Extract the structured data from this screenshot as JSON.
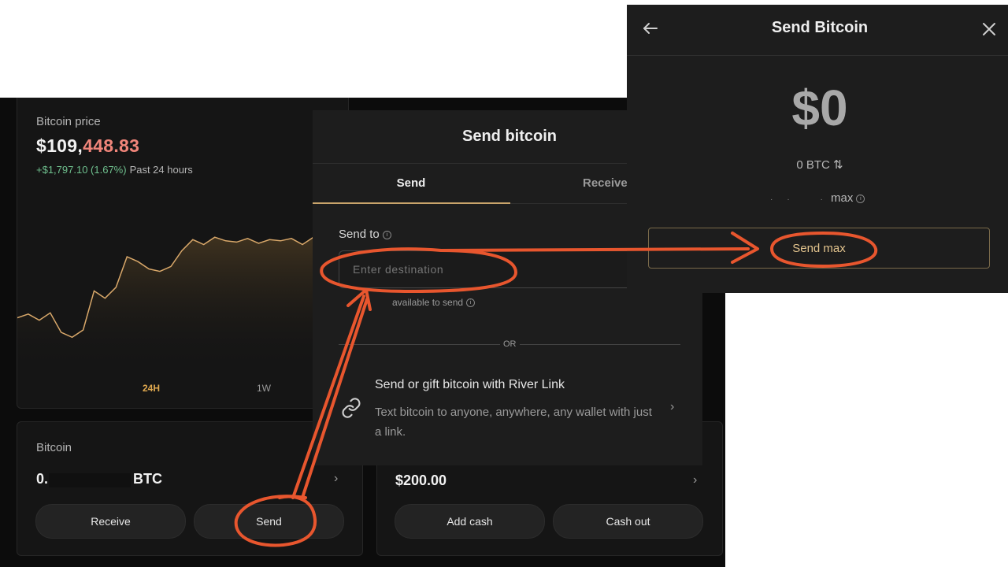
{
  "price_card": {
    "label": "Bitcoin price",
    "price_white": "$109,",
    "price_red": "448.83",
    "change": "+$1,797.10 (1.67%)",
    "period": "Past 24 hours",
    "ranges": [
      "24H",
      "1W"
    ]
  },
  "bitcoin_card": {
    "label": "Bitcoin",
    "amount_prefix": "0.",
    "unit": "BTC",
    "receive_label": "Receive",
    "send_label": "Send"
  },
  "cash_card": {
    "amount": "$200.00",
    "add_cash_label": "Add cash",
    "cash_out_label": "Cash out"
  },
  "send_modal": {
    "title": "Send bitcoin",
    "tab_send": "Send",
    "tab_receive": "Receive",
    "send_to_label": "Send to",
    "destination_placeholder": "Enter destination",
    "available_text": "available to send",
    "or_text": "OR",
    "river_link_title": "Send or gift bitcoin with River Link",
    "river_link_desc": "Text bitcoin to anyone, anywhere, any wallet with just a link."
  },
  "send_max_modal": {
    "title": "Send Bitcoin",
    "amount": "$0",
    "btc_amount": "0 BTC",
    "max_text": "max",
    "send_max_label": "Send max"
  },
  "colors": {
    "background": "#0c0c0c",
    "accent_gold": "#c9a46b",
    "positive": "#6fc08e",
    "price_red": "#f0857a",
    "annotation": "#e8562e"
  },
  "chart_data": {
    "type": "area",
    "ranges": [
      "24H",
      "1W"
    ],
    "selected_range": "24H",
    "values": [
      0.3,
      0.33,
      0.28,
      0.34,
      0.18,
      0.14,
      0.2,
      0.52,
      0.46,
      0.55,
      0.8,
      0.76,
      0.7,
      0.68,
      0.72,
      0.85,
      0.94,
      0.9,
      0.96,
      0.93,
      0.92,
      0.95,
      0.91,
      0.94,
      0.93,
      0.95,
      0.9,
      0.96
    ]
  }
}
